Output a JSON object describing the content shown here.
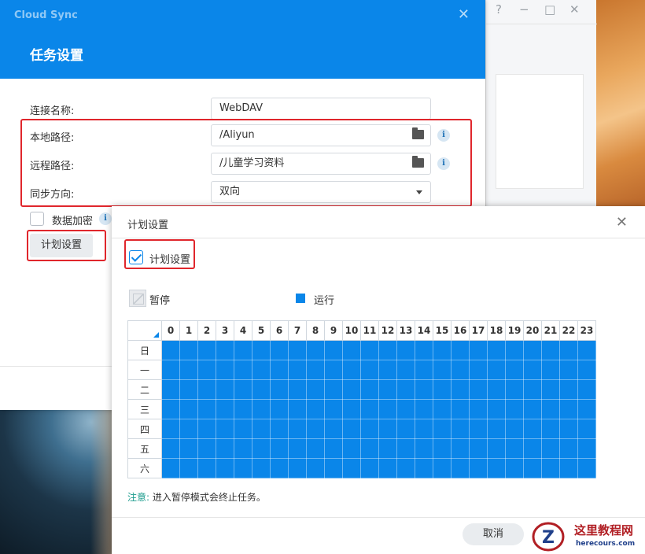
{
  "back_window": {
    "help": "?",
    "minimize": "−",
    "maximize": "□",
    "close": "✕"
  },
  "task_dialog": {
    "app_name": "Cloud Sync",
    "close": "✕",
    "title": "任务设置",
    "fields": {
      "connection_name": {
        "label": "连接名称:",
        "value": "WebDAV"
      },
      "local_path": {
        "label": "本地路径:",
        "value": "/Aliyun"
      },
      "remote_path": {
        "label": "远程路径:",
        "value": "/儿童学习资料"
      },
      "sync_direction": {
        "label": "同步方向:",
        "value": "双向"
      }
    },
    "encrypt_label": "数据加密",
    "schedule_button": "计划设置",
    "info_glyph": "i"
  },
  "schedule_dialog": {
    "title": "计划设置",
    "close": "✕",
    "enable_label": "计划设置",
    "enabled": true,
    "legend": {
      "pause": "暂停",
      "run": "运行"
    },
    "hours": [
      "0",
      "1",
      "2",
      "3",
      "4",
      "5",
      "6",
      "7",
      "8",
      "9",
      "10",
      "11",
      "12",
      "13",
      "14",
      "15",
      "16",
      "17",
      "18",
      "19",
      "20",
      "21",
      "22",
      "23"
    ],
    "days": [
      "日",
      "一",
      "二",
      "三",
      "四",
      "五",
      "六"
    ],
    "all_slots_running": true,
    "note_label": "注意:",
    "note_text": " 进入暂停模式会终止任务。",
    "cancel_button": "取消"
  },
  "watermark": {
    "title": "这里教程网",
    "domain": "herecours.com"
  },
  "colors": {
    "accent": "#0a86e9",
    "highlight": "#e0262c"
  }
}
